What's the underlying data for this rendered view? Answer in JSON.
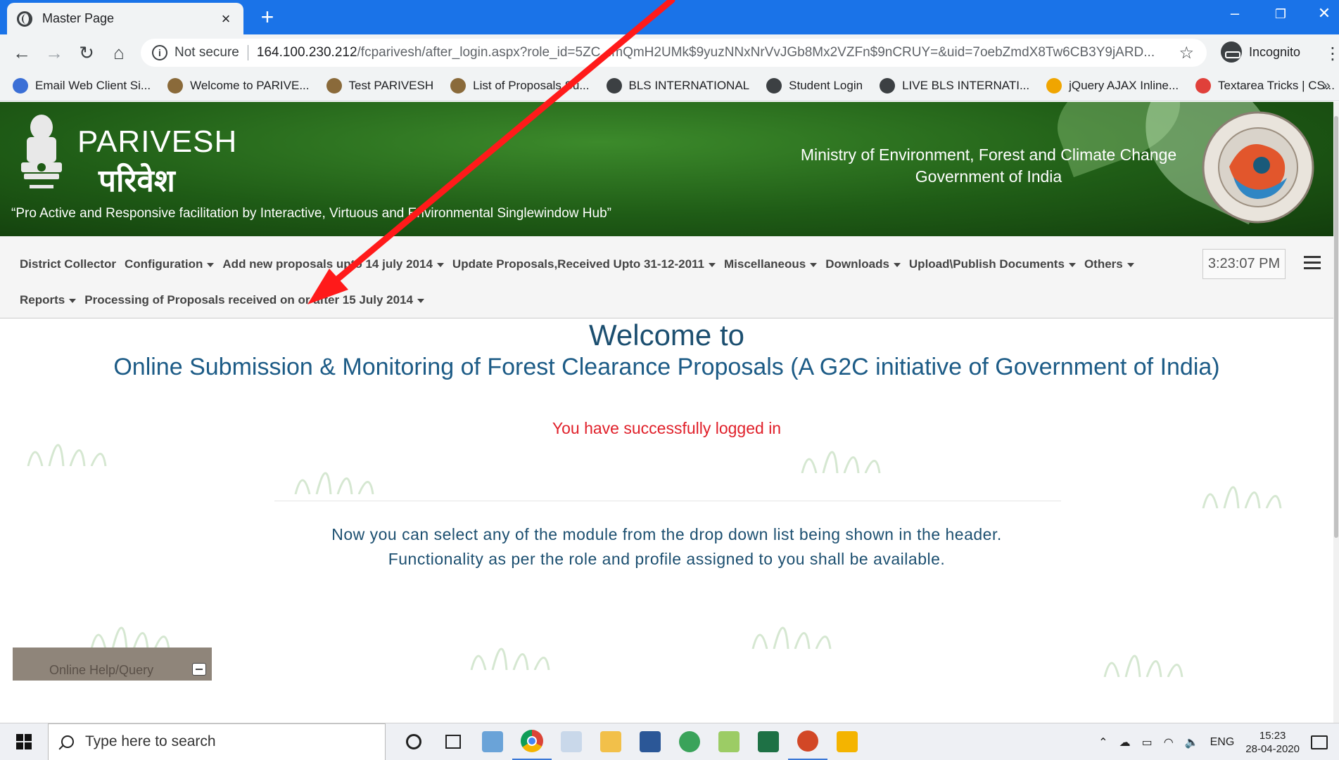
{
  "browser": {
    "tab_title": "Master Page",
    "tab_close": "×",
    "new_tab": "+",
    "not_secure": "Not secure",
    "url_host": "164.100.230.212",
    "url_path": "/fcparivesh/after_login.aspx?role_id=5ZC...mQmH2UMk$9yuzNNxNrVvJGb8Mx2VZFn$9nCRUY=&uid=7oebZmdX8Tw6CB3Y9jARD...",
    "incognito": "Incognito",
    "bookmarks": [
      {
        "label": "Email Web Client Si...",
        "color": "#3b6fd6"
      },
      {
        "label": "Welcome to PARIVE...",
        "color": "#8a6a3a"
      },
      {
        "label": "Test PARIVESH",
        "color": "#8a6a3a"
      },
      {
        "label": "List of Proposals Su...",
        "color": "#8a6a3a"
      },
      {
        "label": "BLS INTERNATIONAL",
        "color": "#3c4043"
      },
      {
        "label": "Student Login",
        "color": "#3c4043"
      },
      {
        "label": "LIVE BLS INTERNATI...",
        "color": "#3c4043"
      },
      {
        "label": "jQuery AJAX Inline...",
        "color": "#f0a500"
      },
      {
        "label": "Textarea Tricks | CS...",
        "color": "#e0403a"
      }
    ],
    "bookmarks_more": "»"
  },
  "header": {
    "logo_en": "PARIVESH",
    "logo_hi": "परिवेश",
    "tagline": "“Pro Active and Responsive facilitation by Interactive, Virtuous and Environmental Singlewindow Hub”",
    "ministry_line1": "Ministry of Environment, Forest and Climate Change",
    "ministry_line2": "Government of India"
  },
  "nav": {
    "row1": [
      {
        "label": "District Collector",
        "caret": false
      },
      {
        "label": "Configuration",
        "caret": true
      },
      {
        "label": "Add new proposals upto 14 july 2014",
        "caret": true
      },
      {
        "label": "Update Proposals,Received Upto 31-12-2011",
        "caret": true
      },
      {
        "label": "Miscellaneous",
        "caret": true
      },
      {
        "label": "Downloads",
        "caret": true
      },
      {
        "label": "Upload\\Publish Documents",
        "caret": true
      },
      {
        "label": "Others",
        "caret": true
      }
    ],
    "row2": [
      {
        "label": "Reports",
        "caret": true
      },
      {
        "label": "Processing of Proposals received on or after 15 July 2014",
        "caret": true
      }
    ],
    "clock": "3:23:07 PM"
  },
  "main": {
    "welcome": "Welcome to",
    "subtitle": "Online Submission & Monitoring of Forest Clearance Proposals (A G2C initiative of Government of India)",
    "success": "You have successfully logged in",
    "info_line1": "Now you can select any of the module from the drop down list being shown in the header.",
    "info_line2": "Functionality as per the role and profile assigned to you shall be available.",
    "help_label": "Online Help/Query"
  },
  "taskbar": {
    "search_placeholder": "Type here to search",
    "lang": "ENG",
    "time": "15:23",
    "date": "28-04-2020"
  },
  "colors": {
    "chrome_blue": "#1a73e8",
    "header_green": "#1f5c16",
    "success_red": "#e0202a",
    "text_blue": "#1c5b86",
    "annotation_arrow": "#ff1a1a"
  }
}
